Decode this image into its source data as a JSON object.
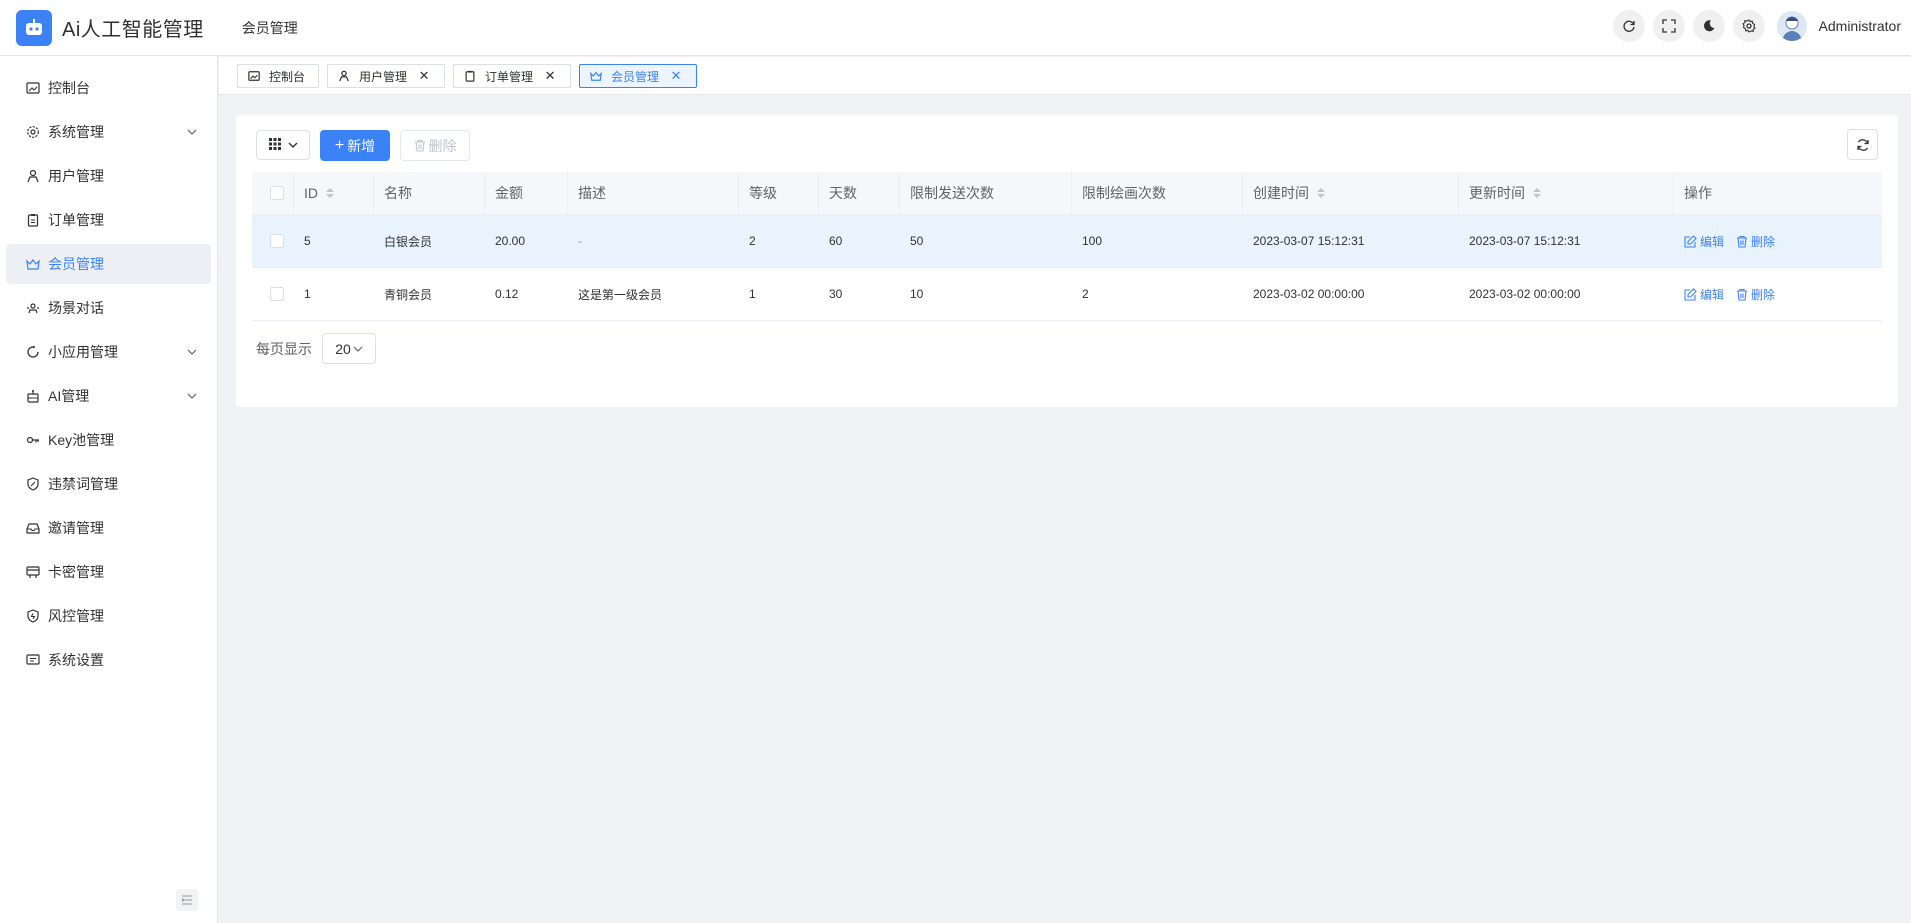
{
  "header": {
    "app_title": "Ai人工智能管理",
    "breadcrumb": "会员管理",
    "username": "Administrator",
    "icons": [
      "refresh-icon",
      "fullscreen-icon",
      "dark-mode-icon",
      "settings-icon",
      "avatar"
    ]
  },
  "sidebar": {
    "items": [
      {
        "label": "控制台",
        "icon": "dashboard-icon"
      },
      {
        "label": "系统管理",
        "icon": "gear-icon",
        "expandable": true
      },
      {
        "label": "用户管理",
        "icon": "user-icon"
      },
      {
        "label": "订单管理",
        "icon": "clipboard-icon"
      },
      {
        "label": "会员管理",
        "icon": "crown-icon",
        "active": true
      },
      {
        "label": "场景对话",
        "icon": "scene-icon"
      },
      {
        "label": "小应用管理",
        "icon": "refresh-circle-icon",
        "expandable": true
      },
      {
        "label": "AI管理",
        "icon": "robot-icon",
        "expandable": true
      },
      {
        "label": "Key池管理",
        "icon": "key-icon"
      },
      {
        "label": "违禁词管理",
        "icon": "shield-icon"
      },
      {
        "label": "邀请管理",
        "icon": "inbox-icon"
      },
      {
        "label": "卡密管理",
        "icon": "card-icon"
      },
      {
        "label": "风控管理",
        "icon": "shield-lock-icon"
      },
      {
        "label": "系统设置",
        "icon": "message-square-icon"
      }
    ]
  },
  "tabs": [
    {
      "label": "控制台",
      "closable": false
    },
    {
      "label": "用户管理",
      "closable": true
    },
    {
      "label": "订单管理",
      "closable": true
    },
    {
      "label": "会员管理",
      "closable": true,
      "active": true
    }
  ],
  "toolbar": {
    "add_label": "新增",
    "delete_label": "删除"
  },
  "table": {
    "columns": [
      "ID",
      "名称",
      "金额",
      "描述",
      "等级",
      "天数",
      "限制发送次数",
      "限制绘画次数",
      "创建时间",
      "更新时间",
      "操作"
    ],
    "rows": [
      {
        "id": "5",
        "name": "白银会员",
        "amount": "20.00",
        "desc": "-",
        "level": "2",
        "days": "60",
        "send_limit": "50",
        "draw_limit": "100",
        "created": "2023-03-07 15:12:31",
        "updated": "2023-03-07 15:12:31"
      },
      {
        "id": "1",
        "name": "青铜会员",
        "amount": "0.12",
        "desc": "这是第一级会员",
        "level": "1",
        "days": "30",
        "send_limit": "10",
        "draw_limit": "2",
        "created": "2023-03-02 00:00:00",
        "updated": "2023-03-02 00:00:00"
      }
    ],
    "actions": {
      "edit": "编辑",
      "delete": "删除"
    }
  },
  "pager": {
    "label": "每页显示",
    "page_size": "20"
  },
  "colors": {
    "primary": "#3b82f6",
    "active_bg": "#ecf0f5",
    "row_highlight": "#e8f3fe"
  }
}
